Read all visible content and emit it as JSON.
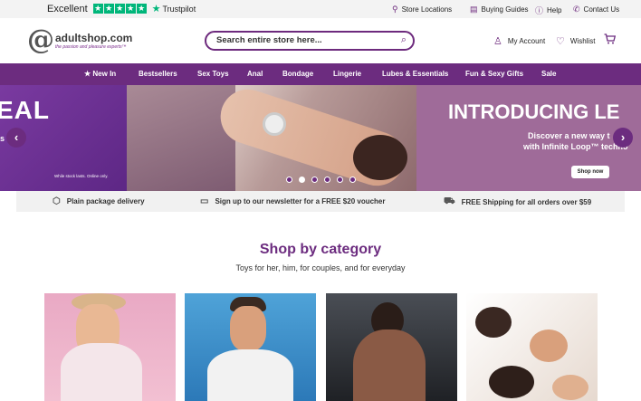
{
  "trustpilot": {
    "rating_text": "Excellent",
    "brand": "Trustpilot",
    "stars": 5,
    "star_color": "#00b67a"
  },
  "utility_links": [
    {
      "label": "Store Locations",
      "icon": "map-pin-icon"
    },
    {
      "label": "Buying Guides",
      "icon": "book-icon"
    },
    {
      "label": "Help",
      "icon": "info-icon"
    },
    {
      "label": "Contact Us",
      "icon": "phone-icon"
    }
  ],
  "header": {
    "logo_name": "adultshop.com",
    "logo_tagline": "the passion and pleasure experts™",
    "search_placeholder": "Search entire store here...",
    "account_label": "My Account",
    "wishlist_label": "Wishlist"
  },
  "nav": [
    {
      "label": "New In",
      "icon": "star-icon"
    },
    {
      "label": "Bestsellers"
    },
    {
      "label": "Sex Toys"
    },
    {
      "label": "Anal"
    },
    {
      "label": "Bondage"
    },
    {
      "label": "Lingerie"
    },
    {
      "label": "Lubes & Essentials"
    },
    {
      "label": "Fun & Sexy Gifts"
    },
    {
      "label": "Sale"
    }
  ],
  "hero": {
    "left_headline": "EAL",
    "left_sub": "s",
    "left_note": "While stock lasts. Online only.",
    "right_headline": "INTRODUCING LE",
    "right_sub_line1": "Discover a new way t",
    "right_sub_line2": "with Infinite Loop™ techno",
    "cta": "Shop now",
    "slide_count": 6,
    "active_slide": 2
  },
  "usps": [
    {
      "label": "Plain package delivery",
      "icon": "package-icon"
    },
    {
      "label": "Sign up to our newsletter for a FREE $20 voucher",
      "icon": "voucher-icon"
    },
    {
      "label": "FREE Shipping for all orders over $59",
      "icon": "truck-icon"
    }
  ],
  "categories": {
    "title": "Shop by category",
    "subtitle": "Toys for her, him, for couples, and for everyday"
  },
  "colors": {
    "brand_purple": "#6c2c7f",
    "nav_purple": "#6c2c7f"
  }
}
